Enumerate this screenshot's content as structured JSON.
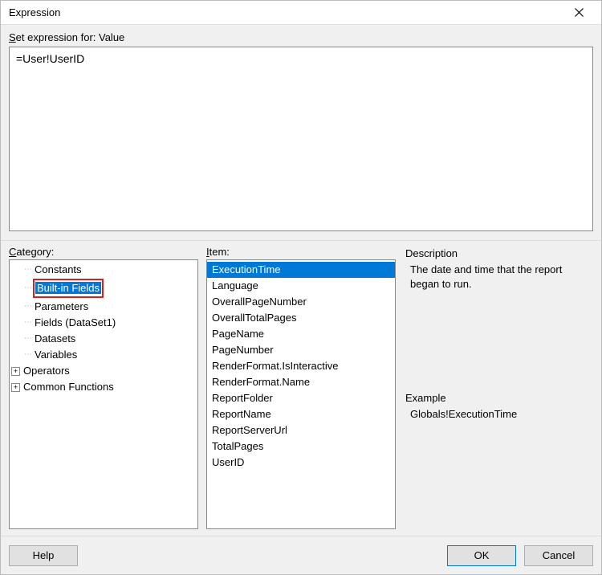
{
  "window": {
    "title": "Expression"
  },
  "editor": {
    "set_label_prefix": "S",
    "set_label_text": "et expression for: Value",
    "value": "=User!UserID"
  },
  "columns": {
    "category_label_u": "C",
    "category_label_rest": "ategory:",
    "item_label_u": "I",
    "item_label_rest": "tem:"
  },
  "category_tree": [
    {
      "expander": "",
      "tick": true,
      "label": "Constants",
      "selected": false,
      "red": false,
      "indent": 1
    },
    {
      "expander": "",
      "tick": true,
      "label": "Built-in Fields",
      "selected": true,
      "red": true,
      "indent": 1
    },
    {
      "expander": "",
      "tick": true,
      "label": "Parameters",
      "selected": false,
      "red": false,
      "indent": 1
    },
    {
      "expander": "",
      "tick": true,
      "label": "Fields (DataSet1)",
      "selected": false,
      "red": false,
      "indent": 1
    },
    {
      "expander": "",
      "tick": true,
      "label": "Datasets",
      "selected": false,
      "red": false,
      "indent": 1
    },
    {
      "expander": "",
      "tick": true,
      "label": "Variables",
      "selected": false,
      "red": false,
      "indent": 1
    },
    {
      "expander": "+",
      "tick": false,
      "label": "Operators",
      "selected": false,
      "red": false,
      "indent": 0
    },
    {
      "expander": "+",
      "tick": false,
      "label": "Common Functions",
      "selected": false,
      "red": false,
      "indent": 0
    }
  ],
  "items": [
    {
      "label": "ExecutionTime",
      "selected": true
    },
    {
      "label": "Language",
      "selected": false
    },
    {
      "label": "OverallPageNumber",
      "selected": false
    },
    {
      "label": "OverallTotalPages",
      "selected": false
    },
    {
      "label": "PageName",
      "selected": false
    },
    {
      "label": "PageNumber",
      "selected": false
    },
    {
      "label": "RenderFormat.IsInteractive",
      "selected": false
    },
    {
      "label": "RenderFormat.Name",
      "selected": false
    },
    {
      "label": "ReportFolder",
      "selected": false
    },
    {
      "label": "ReportName",
      "selected": false
    },
    {
      "label": "ReportServerUrl",
      "selected": false
    },
    {
      "label": "TotalPages",
      "selected": false
    },
    {
      "label": "UserID",
      "selected": false
    }
  ],
  "description": {
    "header": "Description",
    "body": "The date and time that the report began to run."
  },
  "example": {
    "header": "Example",
    "body": "Globals!ExecutionTime"
  },
  "buttons": {
    "help": "Help",
    "ok": "OK",
    "cancel": "Cancel"
  }
}
